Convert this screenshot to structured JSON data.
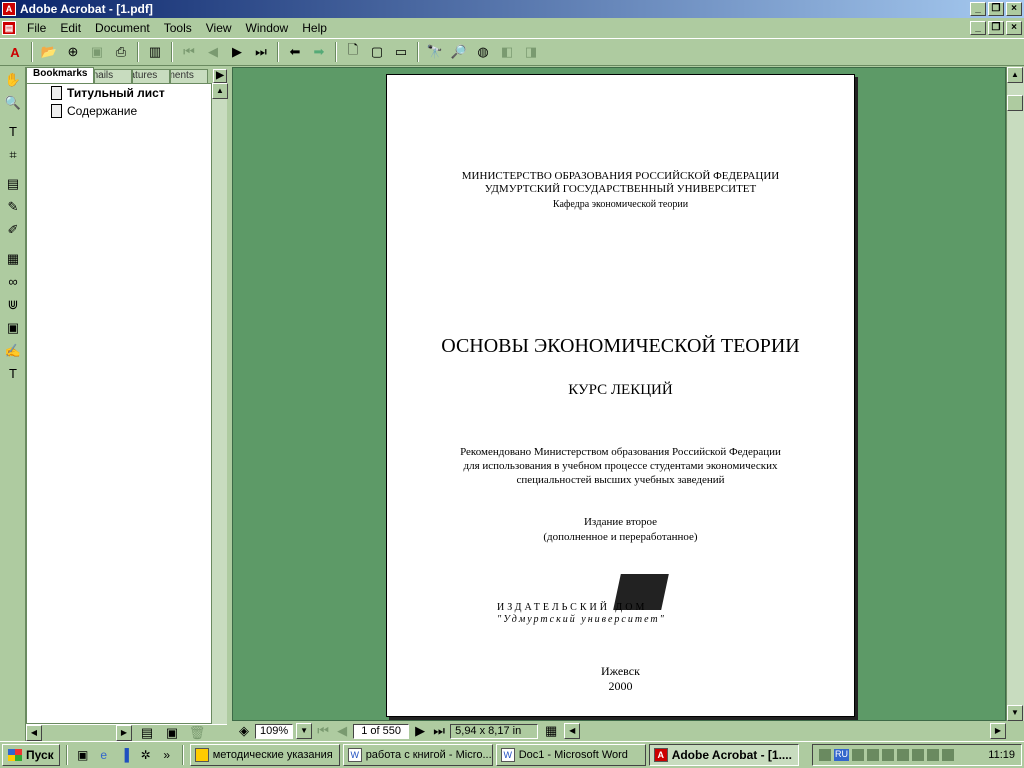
{
  "window": {
    "title": "Adobe Acrobat - [1.pdf]"
  },
  "menu": [
    "File",
    "Edit",
    "Document",
    "Tools",
    "View",
    "Window",
    "Help"
  ],
  "nav": {
    "tabs": [
      "Bookmarks",
      "Thumbnails",
      "Signatures",
      "Comments"
    ],
    "bookmarks": [
      "Титульный лист",
      "Содержание"
    ]
  },
  "document": {
    "header": [
      "МИНИСТЕРСТВО ОБРАЗОВАНИЯ РОССИЙСКОЙ ФЕДЕРАЦИИ",
      "УДМУРТСКИЙ ГОСУДАРСТВЕННЫЙ УНИВЕРСИТЕТ",
      "Кафедра экономической теории"
    ],
    "title": "ОСНОВЫ ЭКОНОМИЧЕСКОЙ ТЕОРИИ",
    "subtitle": "КУРС ЛЕКЦИЙ",
    "recommendation": [
      "Рекомендовано Министерством образования Российской Федерации",
      "для использования в учебном процессе студентами экономических",
      "специальностей высших учебных заведений"
    ],
    "edition": [
      "Издание второе",
      "(дополненное и переработанное)"
    ],
    "publisher": [
      "ИЗДАТЕЛЬСКИЙ ДОМ",
      "\"Удмуртский университет\""
    ],
    "city": "Ижевск",
    "year": "2000"
  },
  "status": {
    "zoom": "109%",
    "page": "1 of 550",
    "size": "5,94 x 8,17 in"
  },
  "taskbar": {
    "start": "Пуск",
    "tasks": [
      "методические указания",
      "работа с книгой - Micro...",
      "Doc1 - Microsoft Word",
      "Adobe Acrobat - [1...."
    ],
    "lang": "RU",
    "clock": "11:19"
  }
}
